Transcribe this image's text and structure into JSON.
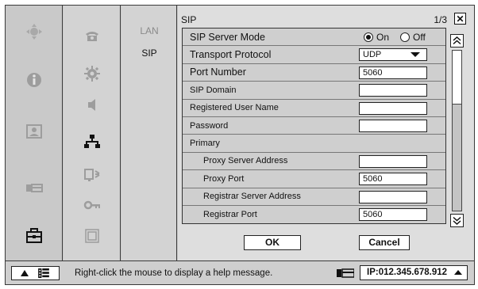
{
  "col3": {
    "items": [
      "LAN",
      "SIP"
    ]
  },
  "panel": {
    "title": "SIP",
    "page": "1/3",
    "close": "✕"
  },
  "rows": [
    {
      "label": "SIP Server Mode",
      "type": "radio",
      "options": [
        "On",
        "Off"
      ],
      "selected": "On"
    },
    {
      "label": "Transport Protocol",
      "type": "select",
      "value": "UDP"
    },
    {
      "label": "Port Number",
      "type": "field",
      "value": "5060"
    },
    {
      "label": "SIP Domain",
      "type": "field",
      "value": ""
    },
    {
      "label": "Registered User Name",
      "type": "field",
      "value": ""
    },
    {
      "label": "Password",
      "type": "field",
      "value": ""
    },
    {
      "label": "Primary",
      "type": "section"
    },
    {
      "label": "Proxy Server Address",
      "type": "field",
      "value": "",
      "indent": true
    },
    {
      "label": "Proxy Port",
      "type": "field",
      "value": "5060",
      "indent": true
    },
    {
      "label": "Registrar Server Address",
      "type": "field",
      "value": "",
      "indent": true
    },
    {
      "label": "Registrar Port",
      "type": "field",
      "value": "5060",
      "indent": true
    }
  ],
  "buttons": {
    "ok": "OK",
    "cancel": "Cancel"
  },
  "scroll": {
    "position_fraction": 0.0,
    "visible_fraction": 0.33
  },
  "status": {
    "help": "Right-click the mouse to display a help message.",
    "ip": "IP:012.345.678.912"
  },
  "rail_icons": [
    "navigation-icon",
    "info-icon",
    "picture-icon",
    "video-camera-icon",
    "toolbox-icon"
  ],
  "col2_icons": [
    "phone-icon",
    "gear-icon",
    "speaker-icon",
    "network-icon",
    "device-icon",
    "key-icon",
    "screen-icon"
  ]
}
